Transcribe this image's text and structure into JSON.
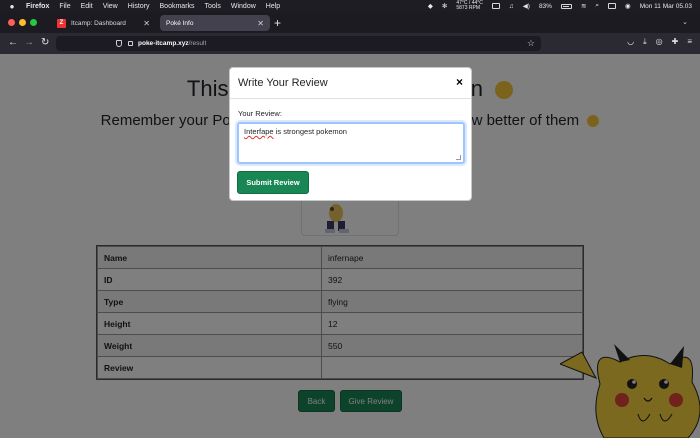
{
  "menubar": {
    "app": "Firefox",
    "items": [
      "File",
      "Edit",
      "View",
      "History",
      "Bookmarks",
      "Tools",
      "Window",
      "Help"
    ],
    "temp_line1": "47°C / 44°C",
    "temp_line2": "5873 RPM",
    "battery": "83%",
    "datetime": "Mon 11 Mar 05.03"
  },
  "tabs": [
    {
      "label": "Itcamp: Dashboard",
      "favicon": "Z"
    },
    {
      "label": "Poké Info"
    }
  ],
  "toolbar": {
    "url_host": "poke-itcamp.xyz",
    "url_path": "/result"
  },
  "page": {
    "heading": "This",
    "heading_tail": "n",
    "subheading_left": "Remember your Pokém",
    "subheading_right": "know better of them",
    "table": [
      {
        "key": "Name",
        "value": "infernape"
      },
      {
        "key": "ID",
        "value": "392"
      },
      {
        "key": "Type",
        "value": "flying"
      },
      {
        "key": "Height",
        "value": "12"
      },
      {
        "key": "Weight",
        "value": "550"
      },
      {
        "key": "Review",
        "value": ""
      }
    ],
    "back_label": "Back",
    "give_review_label": "Give Review"
  },
  "modal": {
    "title": "Write Your Review",
    "close": "×",
    "field_label": "Your Review:",
    "input_value_word": "Interfape",
    "input_value_rest": " is strongest pokemon",
    "submit_label": "Submit Review"
  },
  "colors": {
    "primary_button": "#198754",
    "focus_border": "#9ec5fe"
  }
}
